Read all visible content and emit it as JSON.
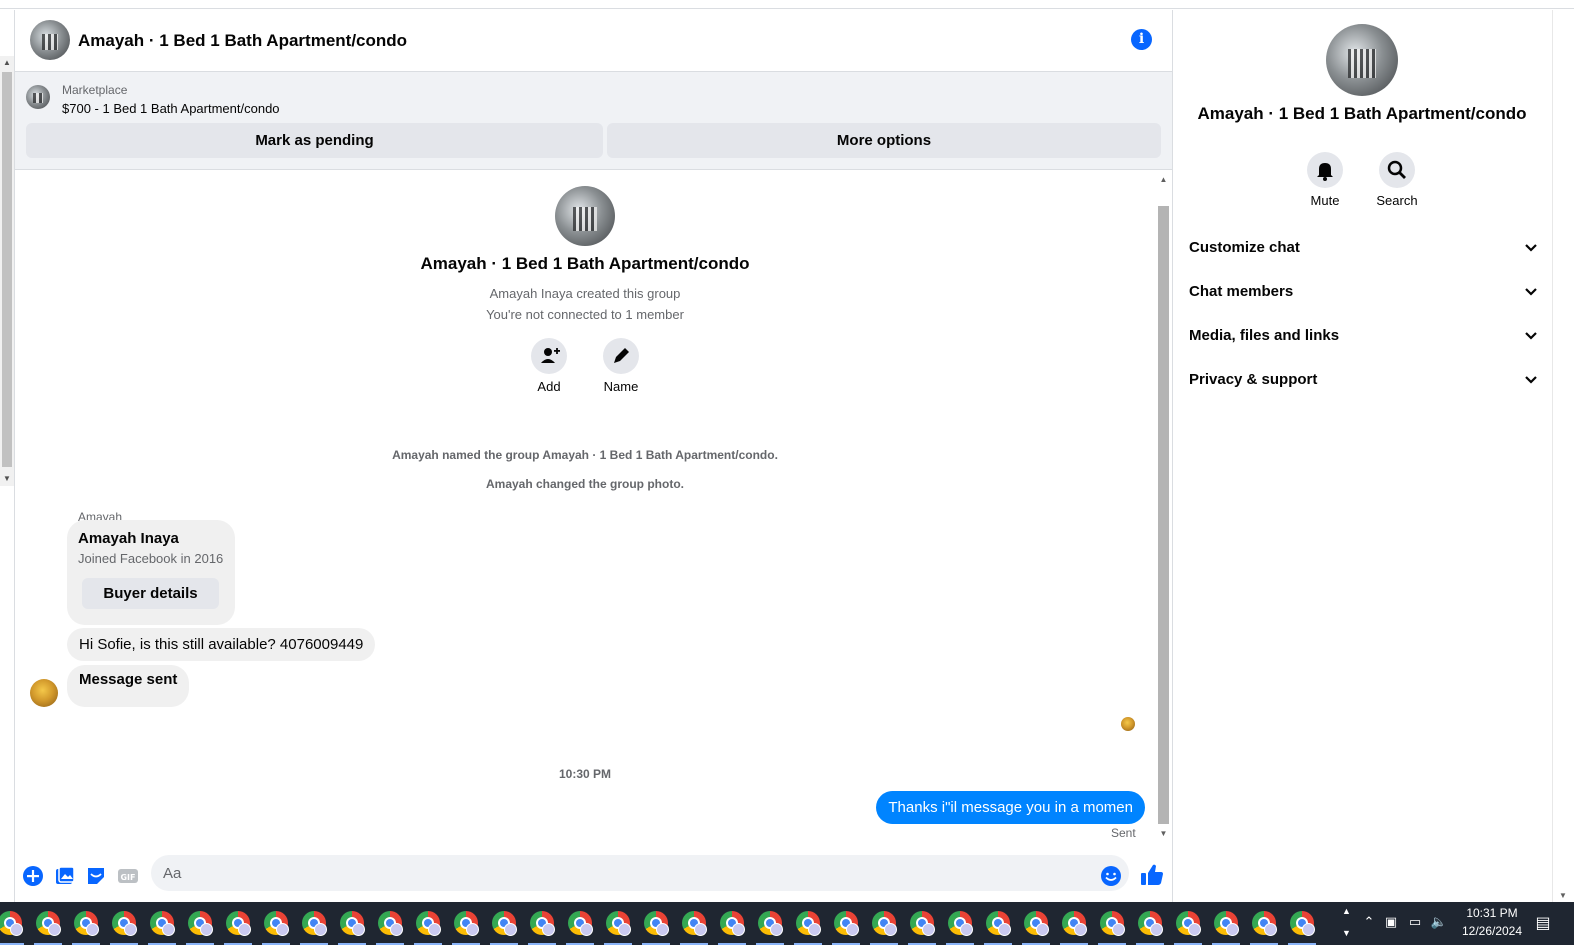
{
  "header": {
    "title": "Amayah · 1 Bed 1 Bath Apartment/condo"
  },
  "marketplace": {
    "label": "Marketplace",
    "listing": "$700 - 1 Bed 1 Bath Apartment/condo",
    "mark_pending": "Mark as pending",
    "more_options": "More options"
  },
  "group": {
    "title": "Amayah · 1 Bed 1 Bath Apartment/condo",
    "created": "Amayah Inaya created this group",
    "not_connected": "You're not connected to 1 member",
    "add_label": "Add",
    "name_label": "Name"
  },
  "events": [
    "Amayah named the group Amayah · 1 Bed 1 Bath Apartment/condo.",
    "Amayah changed the group photo."
  ],
  "card": {
    "sender": "Amayah",
    "name": "Amayah Inaya",
    "joined": "Joined Facebook in 2016",
    "button": "Buyer details"
  },
  "messages": [
    {
      "text": "Hi Sofie, is this still available? 4076009449"
    },
    {
      "text": "Message sent"
    }
  ],
  "timestamp": "10:30 PM",
  "sent_message": {
    "text": "Thanks i\"il message you in a momen",
    "status": "Sent"
  },
  "composer": {
    "placeholder": "Aa"
  },
  "sidebar": {
    "title": "Amayah · 1 Bed 1 Bath Apartment/condo",
    "mute": "Mute",
    "search": "Search",
    "items": [
      {
        "label": "Customize chat"
      },
      {
        "label": "Chat members"
      },
      {
        "label": "Media, files and links"
      },
      {
        "label": "Privacy & support"
      }
    ]
  },
  "taskbar": {
    "time": "10:31 PM",
    "date": "12/26/2024"
  },
  "colors": {
    "accent": "#0866ff",
    "sent_bubble": "#0084ff",
    "bubble": "#f0f0f0",
    "button": "#e4e6eb",
    "taskbar": "#1f2631"
  }
}
